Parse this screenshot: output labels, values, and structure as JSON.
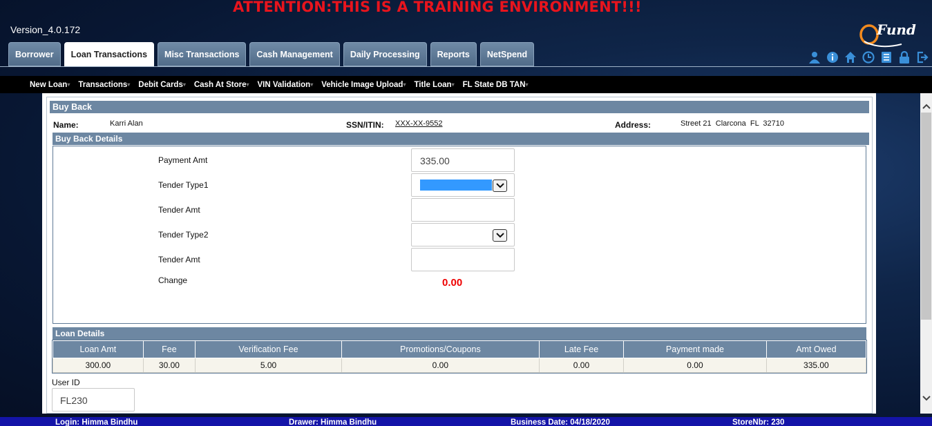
{
  "header": {
    "attention": "ATTENTION:THIS IS A TRAINING ENVIRONMENT!!!",
    "version": "Version_4.0.172",
    "logo_text": "Fund"
  },
  "tabs": [
    {
      "label": "Borrower"
    },
    {
      "label": "Loan Transactions",
      "active": true
    },
    {
      "label": "Misc Transactions"
    },
    {
      "label": "Cash Management"
    },
    {
      "label": "Daily Processing"
    },
    {
      "label": "Reports"
    },
    {
      "label": "NetSpend"
    }
  ],
  "toolbar_icons": [
    "user-icon",
    "info-icon",
    "home-icon",
    "clock-icon",
    "notes-icon",
    "lock-icon",
    "logout-icon"
  ],
  "submenu": [
    {
      "label": "New Loan"
    },
    {
      "label": "Transactions"
    },
    {
      "label": "Debit Cards"
    },
    {
      "label": "Cash At Store"
    },
    {
      "label": "VIN Validation"
    },
    {
      "label": "Vehicle Image Upload"
    },
    {
      "label": "Title Loan"
    },
    {
      "label": "FL State DB TAN"
    }
  ],
  "buyback": {
    "title": "Buy Back",
    "name_label": "Name:",
    "name_value": "Karri Alan",
    "ssn_label": "SSN/ITIN:",
    "ssn_value": "XXX-XX-9552",
    "address_label": "Address:",
    "address_value": "Street 21  Clarcona  FL  32710"
  },
  "details": {
    "title": "Buy Back Details",
    "payment_amt_label": "Payment Amt",
    "payment_amt_value": "335.00",
    "tender_type1_label": "Tender Type1",
    "tender_amt1_label": "Tender Amt",
    "tender_type2_label": "Tender Type2",
    "tender_amt2_label": "Tender Amt",
    "change_label": "Change",
    "change_value": "0.00"
  },
  "loan_details": {
    "title": "Loan Details",
    "columns": [
      "Loan Amt",
      "Fee",
      "Verification Fee",
      "Promotions/Coupons",
      "Late Fee",
      "Payment made",
      "Amt Owed"
    ],
    "row": [
      "300.00",
      "30.00",
      "5.00",
      "0.00",
      "0.00",
      "0.00",
      "335.00"
    ]
  },
  "user": {
    "label": "User ID",
    "value": "FL230"
  },
  "footer": {
    "login": "Login: Himma Bindhu",
    "drawer": "Drawer: Himma Bindhu",
    "business_date": "Business Date: 04/18/2020",
    "store": "StoreNbr: 230"
  },
  "colors": {
    "attention": "#e8141d",
    "header_bar": "#6d87a2",
    "footer": "#1414a8",
    "change": "#e00000"
  }
}
